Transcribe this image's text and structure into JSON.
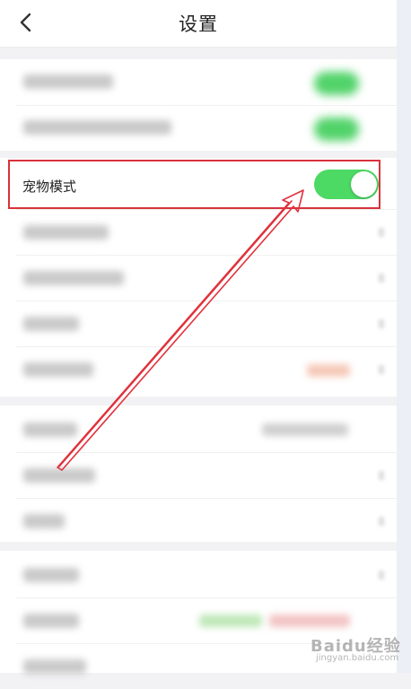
{
  "header": {
    "title": "设置",
    "back_icon": "chevron-left-icon"
  },
  "pet_mode": {
    "label": "宠物模式",
    "enabled": true,
    "toggle_color": "#4cd964"
  },
  "annotation": {
    "box_color": "#d8323c",
    "arrow_color": "#e0323c"
  },
  "watermark": {
    "brand": "Baidu经验",
    "site": "jingyan.baidu.com"
  }
}
